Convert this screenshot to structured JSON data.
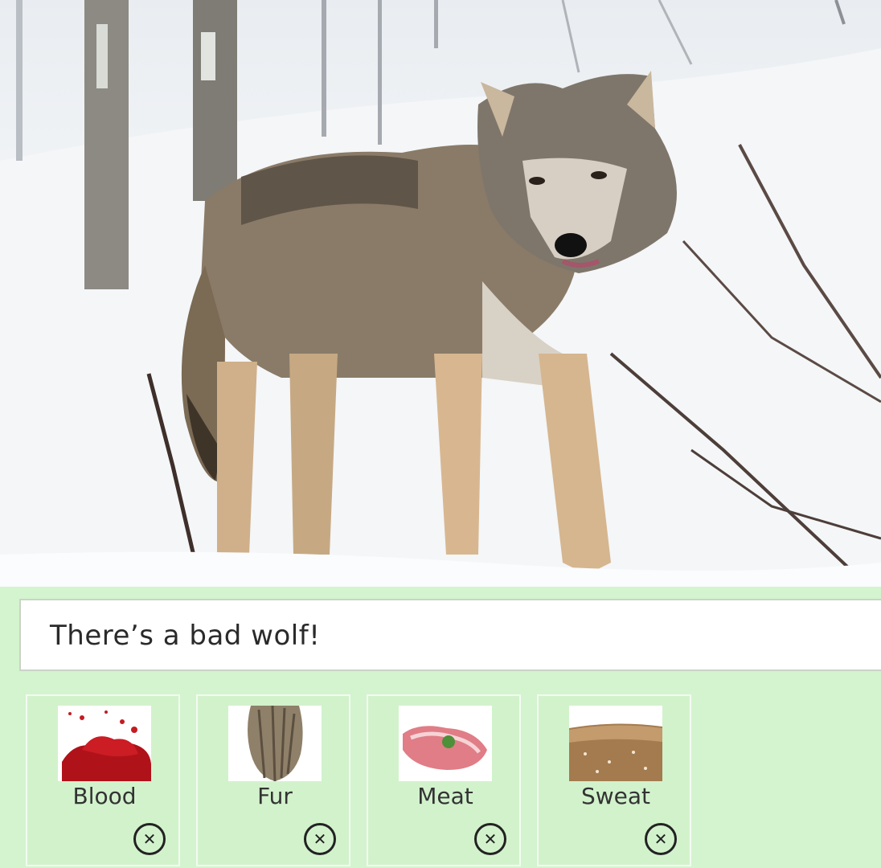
{
  "caption": {
    "text": "There’s a bad wolf!"
  },
  "tags": [
    {
      "label": "Blood",
      "remove_icon": "close-circle-icon"
    },
    {
      "label": "Fur",
      "remove_icon": "close-circle-icon"
    },
    {
      "label": "Meat",
      "remove_icon": "close-circle-icon"
    },
    {
      "label": "Sweat",
      "remove_icon": "close-circle-icon"
    }
  ],
  "colors": {
    "background": "#d4f3cf",
    "caption_bg": "#ffffff",
    "text": "#2a2a2a"
  }
}
